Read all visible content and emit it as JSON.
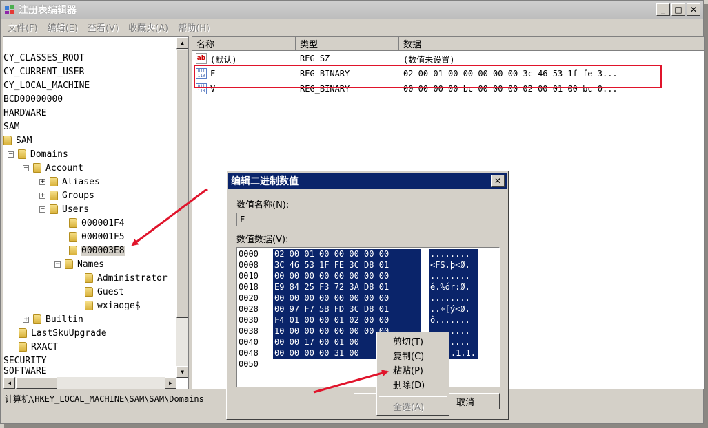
{
  "window": {
    "title": "注册表编辑器"
  },
  "menu": [
    "文件(F)",
    "编辑(E)",
    "查看(V)",
    "收藏夹(A)",
    "帮助(H)"
  ],
  "tree": {
    "items": [
      {
        "label": "CY_CLASSES_ROOT"
      },
      {
        "label": "CY_CURRENT_USER"
      },
      {
        "label": "CY_LOCAL_MACHINE"
      },
      {
        "label": "BCD00000000"
      },
      {
        "label": "HARDWARE"
      },
      {
        "label": "SAM"
      },
      {
        "label": "SAM"
      },
      {
        "label": "Domains"
      },
      {
        "label": "Account"
      },
      {
        "label": "Aliases"
      },
      {
        "label": "Groups"
      },
      {
        "label": "Users"
      },
      {
        "label": "000001F4"
      },
      {
        "label": "000001F5"
      },
      {
        "label": "000003E8"
      },
      {
        "label": "Names"
      },
      {
        "label": "Administrator"
      },
      {
        "label": "Guest"
      },
      {
        "label": "wxiaoge$"
      },
      {
        "label": "Builtin"
      },
      {
        "label": "LastSkuUpgrade"
      },
      {
        "label": "RXACT"
      },
      {
        "label": "SECURITY"
      },
      {
        "label": "SOFTWARE"
      }
    ]
  },
  "list": {
    "columns": [
      "名称",
      "类型",
      "数据"
    ],
    "rows": [
      {
        "name": "(默认)",
        "type": "REG_SZ",
        "data": "(数值未设置)"
      },
      {
        "name": "F",
        "type": "REG_BINARY",
        "data": "02 00 01 00 00 00 00 00 3c 46 53 1f fe 3..."
      },
      {
        "name": "V",
        "type": "REG_BINARY",
        "data": "00 00 00 00 bc 00 00 00 02 00 01 00 bc 0..."
      }
    ]
  },
  "status": {
    "path": "计算机\\HKEY_LOCAL_MACHINE\\SAM\\SAM\\Domains"
  },
  "dialog": {
    "title": "编辑二进制数值",
    "name_label": "数值名称(N):",
    "name_value": "F",
    "data_label": "数值数据(V):",
    "close": "✕",
    "hex_rows": [
      {
        "offset": "0000",
        "bytes": "02 00 01 00 00 00 00 00",
        "ascii": "........"
      },
      {
        "offset": "0008",
        "bytes": "3C 46 53 1F FE 3C D8 01",
        "ascii": "<FS.þ<Ø."
      },
      {
        "offset": "0010",
        "bytes": "00 00 00 00 00 00 00 00",
        "ascii": "........"
      },
      {
        "offset": "0018",
        "bytes": "E9 84 25 F3 72 3A D8 01",
        "ascii": "é.%ór:Ø."
      },
      {
        "offset": "0020",
        "bytes": "00 00 00 00 00 00 00 00",
        "ascii": "........"
      },
      {
        "offset": "0028",
        "bytes": "00 97 F7 5B FD 3C D8 01",
        "ascii": "..÷[ý<Ø."
      },
      {
        "offset": "0030",
        "bytes": "F4 01 00 00 01 02 00 00",
        "ascii": "ô......."
      },
      {
        "offset": "0038",
        "bytes": "10 00 00 00 00 00 00 00",
        "ascii": "........"
      },
      {
        "offset": "0040",
        "bytes": "00 00 17 00 01 00",
        "ascii": "........"
      },
      {
        "offset": "0048",
        "bytes": "00 00 00 00 31 00",
        "ascii": ".1.1."
      },
      {
        "offset": "0050",
        "bytes": "",
        "ascii": ""
      }
    ],
    "cancel": "取消"
  },
  "context_menu": {
    "cut": "剪切(T)",
    "copy": "复制(C)",
    "paste": "粘贴(P)",
    "delete": "删除(D)",
    "select_all": "全选(A)"
  },
  "colors": {
    "selection": "#0a246a",
    "annotation_red": "#e0142b",
    "chrome": "#d4d0c8"
  }
}
